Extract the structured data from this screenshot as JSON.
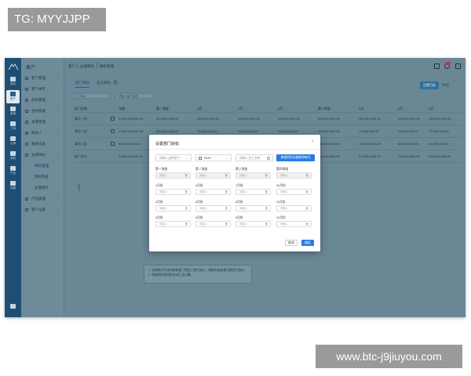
{
  "watermarks": {
    "top": "TG: MYYJJPP",
    "bottom": "www.btc-j9jiuyou.com"
  },
  "sidebar": {
    "items": [
      {
        "label": "首页",
        "icon": "home-icon"
      },
      {
        "label": "客户",
        "icon": "customer-icon",
        "active": true
      },
      {
        "label": "营销",
        "icon": "marketing-icon"
      },
      {
        "label": "工单",
        "icon": "ticket-icon"
      },
      {
        "label": "公海",
        "icon": "pool-icon"
      },
      {
        "label": "采购",
        "icon": "purchase-icon"
      },
      {
        "label": "产品",
        "icon": "product-icon"
      },
      {
        "label": "设置",
        "icon": "settings-icon"
      }
    ]
  },
  "menu": {
    "title": "客户",
    "items": [
      {
        "label": "客户管理",
        "expandable": true
      },
      {
        "label": "客户关怀",
        "expandable": false
      },
      {
        "label": "商机管理",
        "expandable": false
      },
      {
        "label": "合同管理",
        "expandable": true
      },
      {
        "label": "发票管理",
        "expandable": false
      },
      {
        "label": "联系人",
        "expandable": true
      },
      {
        "label": "跟进记录",
        "expandable": false
      },
      {
        "label": "业绩目标",
        "expandable": true,
        "open": true
      }
    ],
    "subitems": [
      {
        "label": "目标管理",
        "active": true
      },
      {
        "label": "目标完成",
        "active": false
      },
      {
        "label": "业绩统计",
        "active": false
      }
    ],
    "items_after": [
      {
        "label": "产品管理",
        "expandable": true
      },
      {
        "label": "客户设置",
        "expandable": true
      }
    ]
  },
  "breadcrumb": [
    "客户",
    "业绩目标",
    "目标管理"
  ],
  "tabs": [
    {
      "label": "部门目标",
      "active": true
    },
    {
      "label": "员工目标",
      "active": false
    }
  ],
  "actions": {
    "set_target": "设置目标",
    "export": "导出"
  },
  "filters": {
    "year": "2025",
    "department": "请输入部门名称"
  },
  "table": {
    "columns": [
      "部门名称",
      "年度",
      "第一季度",
      "1月",
      "2月",
      "3月",
      "第二季度",
      "4月",
      "5月",
      "6月"
    ],
    "rows": [
      [
        "事业一部",
        "3,000,000,000.00",
        "300,000,000.00",
        "100,000,000.00",
        "100,000,000.00",
        "100,000,000.00",
        "300,000,000.00",
        "100,000,000.00",
        "100,000,000.00",
        "100,000,000.00"
      ],
      [
        "事业二部",
        "1,000,000,000.00",
        "300,000,000.00",
        "70,000,000.00",
        "70,000,000.00",
        "70,000,000.00",
        "100,000,000.00",
        "70,000,000.00",
        "70,000,000.00",
        "70,000,000.00"
      ],
      [
        "事业三部",
        "500,000,000.00",
        "100,000,000.00",
        "40,000,000.00",
        "40,000,000.00",
        "40,000,000.00",
        "300,000,000.00",
        "100,000,000.00",
        "40,000,000.00",
        "40,000,000.00"
      ],
      [
        "部门合计",
        "4,500,000,000.00",
        "700,000,000.00",
        "210,000,000.00",
        "210,000,000.00",
        "210,000,000.00",
        "700,000,000.00",
        "270,000,000.00",
        "210,000,000.00",
        "210,000,000.00"
      ]
    ]
  },
  "hint": {
    "lines": [
      "1. 业绩统计中支持按照部门和员工进行统计，按照年度或者月度进行统计。",
      "2. 季度和年度目标自动汇总计算。"
    ]
  },
  "modal": {
    "title": "设置部门目标",
    "close": "×",
    "department_placeholder": "请输入选择部门",
    "year": "2025",
    "employee_placeholder": "请输入员工名称",
    "copy_button": "按相同目标复制到每月",
    "fields": [
      {
        "label": "第一季度",
        "placeholder": "请输入",
        "unit": "元",
        "shaded": true
      },
      {
        "label": "第二季度",
        "placeholder": "请输入",
        "unit": "元",
        "shaded": true
      },
      {
        "label": "第三季度",
        "placeholder": "请输入",
        "unit": "元",
        "shaded": true
      },
      {
        "label": "第四季度",
        "placeholder": "请输入",
        "unit": "元",
        "shaded": true
      },
      {
        "label": "1月份",
        "placeholder": "请输入",
        "unit": "元"
      },
      {
        "label": "4月份",
        "placeholder": "请输入",
        "unit": "元"
      },
      {
        "label": "7月份",
        "placeholder": "请输入",
        "unit": "元"
      },
      {
        "label": "10月份",
        "placeholder": "请输入",
        "unit": "元"
      },
      {
        "label": "2月份",
        "placeholder": "请输入",
        "unit": "元"
      },
      {
        "label": "5月份",
        "placeholder": "请输入",
        "unit": "元"
      },
      {
        "label": "8月份",
        "placeholder": "请输入",
        "unit": "元"
      },
      {
        "label": "11月份",
        "placeholder": "请输入",
        "unit": "元"
      },
      {
        "label": "3月份",
        "placeholder": "请输入",
        "unit": "元"
      },
      {
        "label": "6月份",
        "placeholder": "请输入",
        "unit": "元"
      },
      {
        "label": "9月份",
        "placeholder": "请输入",
        "unit": "元"
      },
      {
        "label": "12月份",
        "placeholder": "请输入",
        "unit": "元"
      }
    ],
    "cancel": "取消",
    "ok": "确定"
  }
}
